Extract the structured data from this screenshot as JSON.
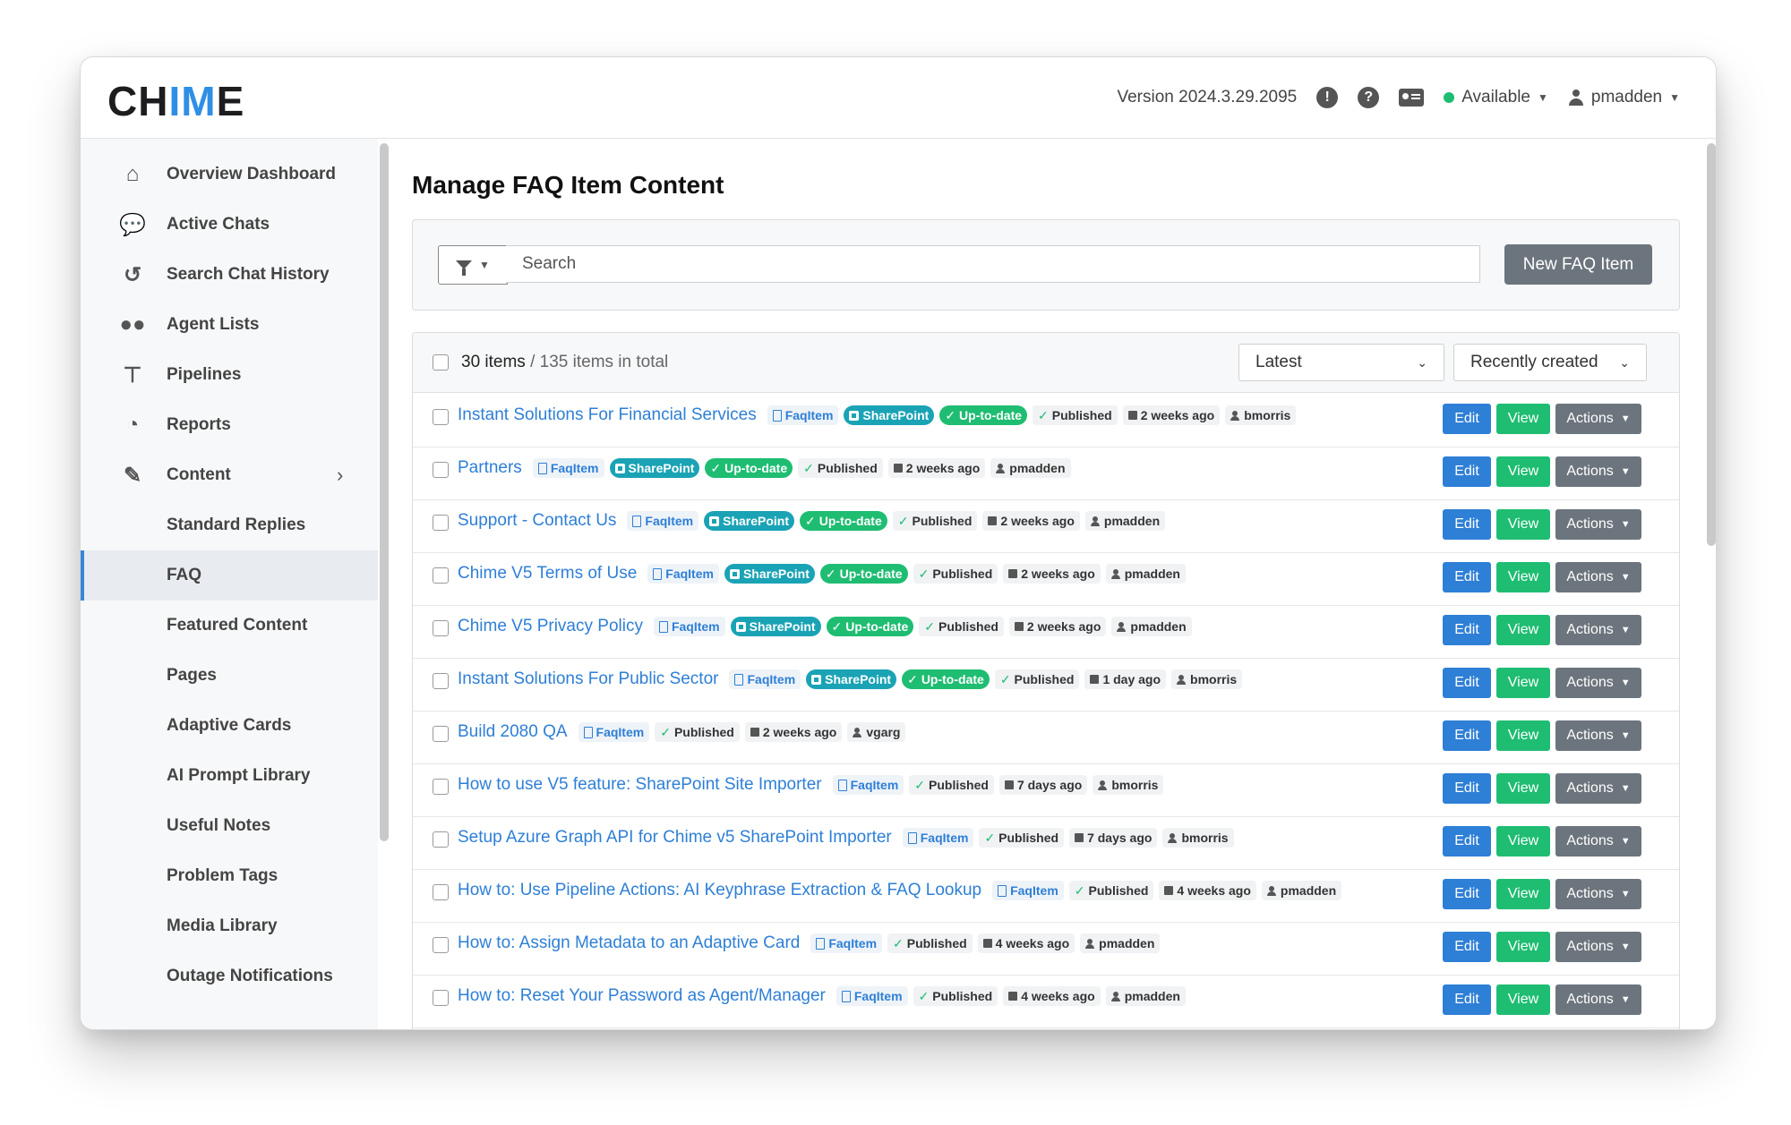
{
  "app": {
    "logo_prefix": "CH",
    "logo_accent": "IM",
    "logo_suffix": "E",
    "version": "Version 2024.3.29.2095",
    "status": "Available",
    "user": "pmadden"
  },
  "sidebar": {
    "items": [
      {
        "label": "Overview Dashboard",
        "icon": "home-icon"
      },
      {
        "label": "Active Chats",
        "icon": "chat-bubbles-icon"
      },
      {
        "label": "Search Chat History",
        "icon": "history-icon"
      },
      {
        "label": "Agent Lists",
        "icon": "users-icon"
      },
      {
        "label": "Pipelines",
        "icon": "branch-icon"
      },
      {
        "label": "Reports",
        "icon": "pie-chart-icon"
      },
      {
        "label": "Content",
        "icon": "edit-icon"
      },
      {
        "label": "Standard Replies"
      },
      {
        "label": "FAQ"
      },
      {
        "label": "Featured Content"
      },
      {
        "label": "Pages"
      },
      {
        "label": "Adaptive Cards"
      },
      {
        "label": "AI Prompt Library"
      },
      {
        "label": "Useful Notes"
      },
      {
        "label": "Problem Tags"
      },
      {
        "label": "Media Library"
      },
      {
        "label": "Outage Notifications"
      }
    ]
  },
  "main": {
    "title": "Manage FAQ Item Content",
    "search_placeholder": "Search",
    "new_button": "New FAQ Item",
    "count_items": "30 items",
    "count_total": " / 135 items in total",
    "sort_select": "Latest",
    "order_select": "Recently created",
    "btn_edit": "Edit",
    "btn_view": "View",
    "btn_actions": "Actions",
    "colors": {
      "accent": "#2e7fd6",
      "success": "#1fbd72",
      "sharepoint": "#1aa3b5",
      "secondary": "#6c757d"
    },
    "rows": [
      {
        "title": "Instant Solutions For Financial Services",
        "type": "FaqItem",
        "sharepoint": "SharePoint",
        "sync": "Up-to-date",
        "status": "Published",
        "time": "2 weeks ago",
        "user": "bmorris"
      },
      {
        "title": "Partners",
        "type": "FaqItem",
        "sharepoint": "SharePoint",
        "sync": "Up-to-date",
        "status": "Published",
        "time": "2 weeks ago",
        "user": "pmadden"
      },
      {
        "title": "Support - Contact Us",
        "type": "FaqItem",
        "sharepoint": "SharePoint",
        "sync": "Up-to-date",
        "status": "Published",
        "time": "2 weeks ago",
        "user": "pmadden"
      },
      {
        "title": "Chime V5 Terms of Use",
        "type": "FaqItem",
        "sharepoint": "SharePoint",
        "sync": "Up-to-date",
        "status": "Published",
        "time": "2 weeks ago",
        "user": "pmadden"
      },
      {
        "title": "Chime V5 Privacy Policy",
        "type": "FaqItem",
        "sharepoint": "SharePoint",
        "sync": "Up-to-date",
        "status": "Published",
        "time": "2 weeks ago",
        "user": "pmadden"
      },
      {
        "title": "Instant Solutions For Public Sector",
        "type": "FaqItem",
        "sharepoint": "SharePoint",
        "sync": "Up-to-date",
        "status": "Published",
        "time": "1 day ago",
        "user": "bmorris"
      },
      {
        "title": "Build 2080 QA",
        "type": "FaqItem",
        "status": "Published",
        "time": "2 weeks ago",
        "user": "vgarg"
      },
      {
        "title": "How to use V5 feature: SharePoint Site Importer",
        "type": "FaqItem",
        "status": "Published",
        "time": "7 days ago",
        "user": "bmorris"
      },
      {
        "title": "Setup Azure Graph API for Chime v5 SharePoint Importer",
        "type": "FaqItem",
        "status": "Published",
        "time": "7 days ago",
        "user": "bmorris"
      },
      {
        "title": "How to: Use Pipeline Actions: AI Keyphrase Extraction & FAQ Lookup",
        "type": "FaqItem",
        "status": "Published",
        "time": "4 weeks ago",
        "user": "pmadden"
      },
      {
        "title": "How to: Assign Metadata to an Adaptive Card",
        "type": "FaqItem",
        "status": "Published",
        "time": "4 weeks ago",
        "user": "pmadden"
      },
      {
        "title": "How to: Reset Your Password as Agent/Manager",
        "type": "FaqItem",
        "status": "Published",
        "time": "4 weeks ago",
        "user": "pmadden"
      }
    ]
  }
}
